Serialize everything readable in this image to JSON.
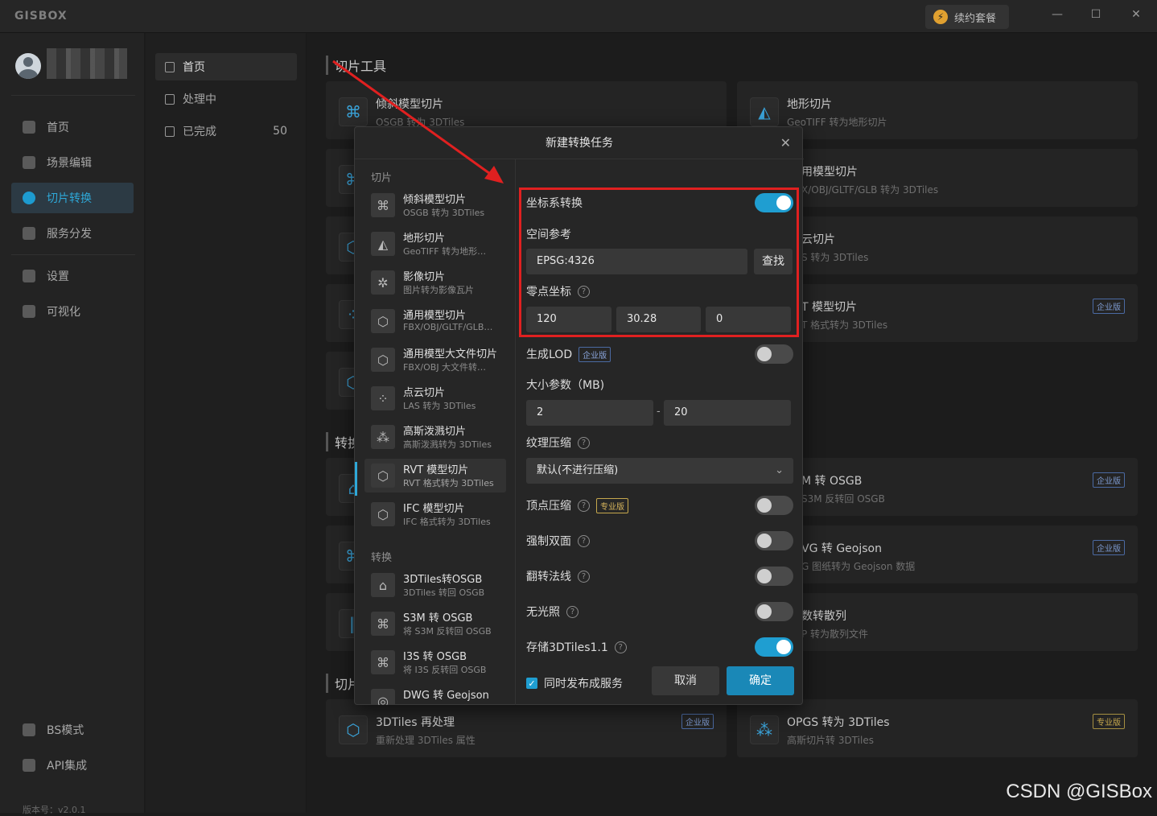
{
  "app": {
    "logo": "GISBOX",
    "renew_label": "续约套餐",
    "window_controls": [
      "—",
      "☐",
      "✕"
    ]
  },
  "sidebar": {
    "items": [
      {
        "label": "首页",
        "icon": "home-icon"
      },
      {
        "label": "场景编辑",
        "icon": "cube-icon"
      },
      {
        "label": "切片转换",
        "icon": "swap-icon",
        "active": true
      },
      {
        "label": "服务分发",
        "icon": "upload-icon"
      },
      {
        "label": "设置",
        "icon": "gear-icon"
      },
      {
        "label": "可视化",
        "icon": "chart-icon"
      }
    ],
    "bottom": [
      {
        "label": "BS模式",
        "icon": "bs-icon"
      },
      {
        "label": "API集成",
        "icon": "api-icon"
      }
    ],
    "version": "版本号：v2.0.1"
  },
  "subpanel": {
    "items": [
      {
        "label": "首页",
        "active": true
      },
      {
        "label": "处理中"
      },
      {
        "label": "已完成",
        "count": "50"
      }
    ]
  },
  "main": {
    "section1_title": "切片工具",
    "section2_title": "转换",
    "section3_title": "切片",
    "cards_left": [
      {
        "title": "倾斜模型切片",
        "sub": "OSGB 转为 3DTiles"
      }
    ],
    "cards_right": [
      {
        "title": "地形切片",
        "sub": "GeoTIFF 转为地形切片"
      },
      {
        "title": "用模型切片",
        "sub": "X/OBJ/GLTF/GLB 转为 3DTiles"
      },
      {
        "title": "云切片",
        "sub": "S 转为 3DTiles"
      },
      {
        "title": "T 模型切片",
        "sub": "T 格式转为 3DTiles",
        "badge": "企业版"
      },
      {
        "title": "M 转 OSGB",
        "sub": "S3M 反转回 OSGB",
        "badge": "企业版"
      },
      {
        "title": "VG 转 Geojson",
        "sub": "G 图纸转为 Geojson 数据",
        "badge": "企业版"
      },
      {
        "title": "数转散列",
        "sub": "P 转为散列文件"
      }
    ],
    "bottom_left": {
      "title": "3DTiles 再处理",
      "sub": "重新处理 3DTiles 属性",
      "badge": "企业版"
    },
    "bottom_right": {
      "title": "OPGS 转为 3DTiles",
      "sub": "高斯切片转 3DTiles",
      "badge": "专业版"
    }
  },
  "modal": {
    "title": "新建转换任务",
    "group1": "切片",
    "group2": "转换",
    "items1": [
      {
        "title": "倾斜模型切片",
        "sub": "OSGB 转为 3DTiles",
        "icon": "drone-icon"
      },
      {
        "title": "地形切片",
        "sub": "GeoTIFF 转为地形…",
        "icon": "terrain-icon"
      },
      {
        "title": "影像切片",
        "sub": "图片转为影像瓦片",
        "icon": "satellite-icon"
      },
      {
        "title": "通用模型切片",
        "sub": "FBX/OBJ/GLTF/GLB…",
        "icon": "box-icon"
      },
      {
        "title": "通用模型大文件切片",
        "sub": "FBX/OBJ 大文件转…",
        "icon": "box-icon"
      },
      {
        "title": "点云切片",
        "sub": "LAS 转为 3DTiles",
        "icon": "pointcloud-icon"
      },
      {
        "title": "高斯泼溅切片",
        "sub": "高斯泼溅转为 3DTiles",
        "icon": "pointcloud-icon"
      },
      {
        "title": "RVT 模型切片",
        "sub": "RVT 格式转为 3DTiles",
        "icon": "box-icon",
        "active": true
      },
      {
        "title": "IFC 模型切片",
        "sub": "IFC 格式转为 3DTiles",
        "icon": "box-icon"
      }
    ],
    "items2": [
      {
        "title": "3DTiles转OSGB",
        "sub": "3DTiles 转回 OSGB",
        "icon": "building-icon"
      },
      {
        "title": "S3M 转 OSGB",
        "sub": "将 S3M 反转回 OSGB",
        "icon": "drone-icon"
      },
      {
        "title": "I3S 转 OSGB",
        "sub": "将 I3S 反转回 OSGB",
        "icon": "drone-icon"
      },
      {
        "title": "DWG 转 Geojson",
        "sub": "",
        "icon": "dwg-icon"
      }
    ],
    "form": {
      "coord_transform": "坐标系转换",
      "spatial_ref": "空间参考",
      "srs_value": "EPSG:4326",
      "find": "查找",
      "origin": "零点坐标",
      "origin_x": "120",
      "origin_y": "30.28",
      "origin_z": "0",
      "lod": "生成LOD",
      "enterprise": "企业版",
      "professional": "专业版",
      "size_param": "大小参数（MB)",
      "size_min": "2",
      "size_sep": "-",
      "size_max": "20",
      "texture": "纹理压缩",
      "texture_value": "默认(不进行压缩)",
      "vertex": "顶点压缩",
      "double_side": "强制双面",
      "flip_normal": "翻转法线",
      "no_light": "无光照",
      "store_1_1": "存储3DTiles1.1",
      "publish": "同时发布成服务",
      "cancel": "取消",
      "ok": "确定"
    }
  },
  "watermark": "CSDN @GISBox"
}
